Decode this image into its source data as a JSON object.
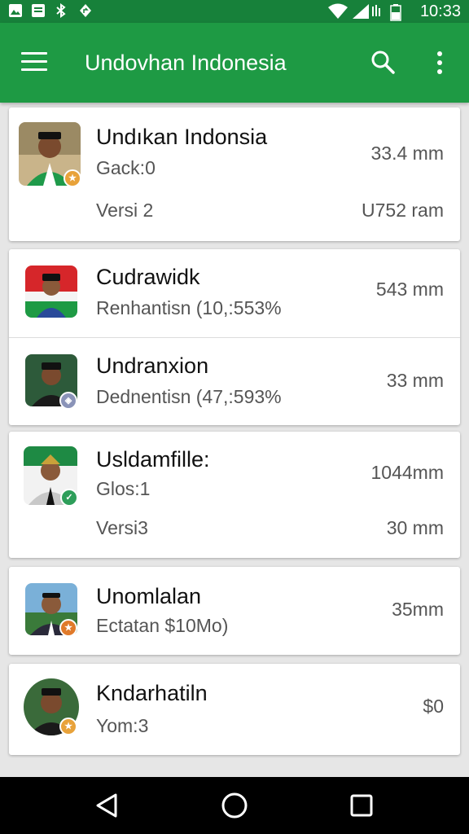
{
  "status_bar": {
    "time": "10:33",
    "icons": [
      "image-icon",
      "notification-icon",
      "bluetooth-icon",
      "location-icon",
      "wifi-icon",
      "signal-icon",
      "battery-icon"
    ]
  },
  "app_bar": {
    "title": "Undovhan Indonesia",
    "icons": [
      "menu-icon",
      "search-icon",
      "more-vert-icon"
    ]
  },
  "cards": [
    {
      "rows": [
        {
          "title": "Undıkan Indonsia",
          "subtitle": "Gack:0",
          "value": "33.4 mm",
          "version": "Versi 2",
          "version_value": "U752 ram",
          "badge_color": "#e8a23a",
          "badge_icon": "star-badge-icon"
        }
      ]
    },
    {
      "rows": [
        {
          "title": "Cudrawidk",
          "subtitle": "Renhantisn (10,:553%",
          "value": "543 mm",
          "badge_color": "",
          "badge_icon": ""
        },
        {
          "title": "Undranxion",
          "subtitle": "Dednentisn (47,:593%",
          "value": "33 mm",
          "badge_color": "#8a93b8",
          "badge_icon": "shield-badge-icon"
        }
      ]
    },
    {
      "rows": [
        {
          "title": "Usldamfille:",
          "subtitle": "Glos:1",
          "value": "1044mm",
          "version": "Versi3",
          "version_value": "30 mm",
          "badge_color": "#2e9e5a",
          "badge_icon": "check-badge-icon"
        }
      ]
    },
    {
      "rows": [
        {
          "title": "Unomlalan",
          "subtitle": "Ectatan $10Mo)",
          "value": "35mm",
          "badge_color": "#e07a2a",
          "badge_icon": "star-badge-icon"
        }
      ]
    },
    {
      "rows": [
        {
          "title": "Kndarhatiln",
          "subtitle": "Yom:3",
          "value": "$0",
          "badge_color": "#e8a23a",
          "badge_icon": "star-badge-icon"
        }
      ]
    }
  ],
  "colors": {
    "status_bar": "#17813a",
    "app_bar": "#1e9a44",
    "background": "#e6e6e6"
  },
  "nav_bar": {
    "icons": [
      "back-icon",
      "home-icon",
      "recents-icon"
    ]
  }
}
